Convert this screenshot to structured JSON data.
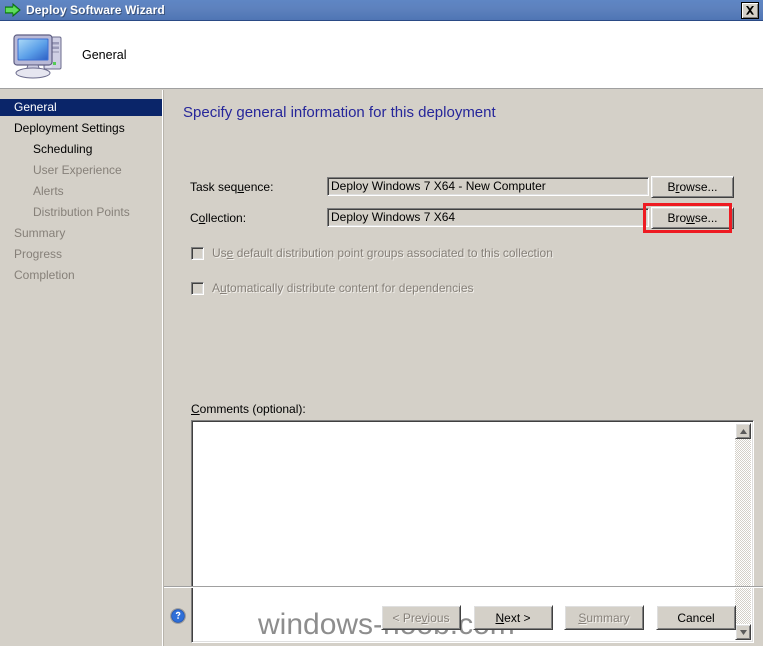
{
  "window": {
    "title": "Deploy Software Wizard",
    "title_icon": "green-arrow-icon",
    "close_label": "×",
    "titlebar_color": "#5d81bd"
  },
  "header": {
    "step_title": "General",
    "icon": "computer-icon"
  },
  "sidebar": {
    "items": [
      {
        "label": "General",
        "state": "selected",
        "indent": false
      },
      {
        "label": "Deployment Settings",
        "state": "active",
        "indent": false
      },
      {
        "label": "Scheduling",
        "state": "active",
        "indent": true
      },
      {
        "label": "User Experience",
        "state": "disabled",
        "indent": true
      },
      {
        "label": "Alerts",
        "state": "disabled",
        "indent": true
      },
      {
        "label": "Distribution Points",
        "state": "disabled",
        "indent": true
      },
      {
        "label": "Summary",
        "state": "disabled",
        "indent": false
      },
      {
        "label": "Progress",
        "state": "disabled",
        "indent": false
      },
      {
        "label": "Completion",
        "state": "disabled",
        "indent": false
      }
    ],
    "selected_bg": "#0a2569"
  },
  "main": {
    "heading": "Specify general information for this deployment",
    "heading_color": "#26269a",
    "fields": [
      {
        "label_pre": "Task seq",
        "label_acc": "u",
        "label_post": "ence:",
        "value": "Deploy Windows 7 X64 - New Computer",
        "browse_pre": "B",
        "browse_acc": "r",
        "browse_post": "owse...",
        "browse_label": "Browse...",
        "highlighted": false
      },
      {
        "label_pre": "C",
        "label_acc": "o",
        "label_post": "llection:",
        "value": "Deploy Windows 7 X64",
        "browse_pre": "Bro",
        "browse_acc": "w",
        "browse_post": "se...",
        "browse_label": "Browse...",
        "highlighted": true
      }
    ],
    "checkboxes": [
      {
        "pre": "Us",
        "acc": "e",
        "post": " default distribution point groups associated to this collection",
        "checked": false,
        "enabled": false
      },
      {
        "pre": "A",
        "acc": "u",
        "post": "tomatically distribute content for dependencies",
        "checked": false,
        "enabled": false
      }
    ],
    "comments": {
      "label_pre": "C",
      "label_acc": "",
      "label_post": "omments (optional):",
      "value": "",
      "scroll_up_icon": "triangle-up-icon",
      "scroll_down_icon": "triangle-down-icon"
    },
    "highlight_color": "#ee1b22"
  },
  "footer": {
    "help_icon": "help-question-icon",
    "buttons": [
      {
        "pre": "< Pre",
        "acc": "v",
        "post": "ious",
        "label": "< Previous",
        "enabled": false
      },
      {
        "pre": "",
        "acc": "N",
        "post": "ext >",
        "label": "Next >",
        "enabled": true
      },
      {
        "pre": "",
        "acc": "S",
        "post": "ummary",
        "label": "Summary",
        "enabled": false
      },
      {
        "pre": "Cancel",
        "acc": "",
        "post": "",
        "label": "Cancel",
        "enabled": true
      }
    ]
  },
  "watermark": {
    "text": "windows-noob.com"
  }
}
